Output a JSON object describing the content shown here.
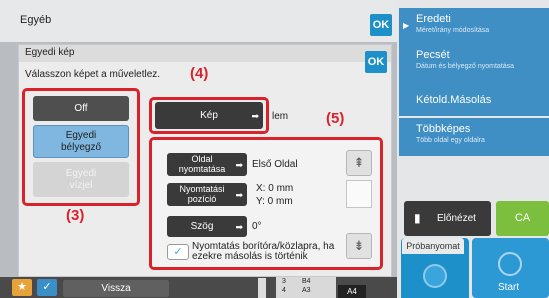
{
  "header": {
    "title": "Egyéb",
    "ok_label": "OK"
  },
  "dialog": {
    "title": "Egyedi kép",
    "ok_label": "OK",
    "instruction": "Válasszon képet a műveletlez.",
    "stamp_options": [
      {
        "label": "Off",
        "state": "normal"
      },
      {
        "label": "Egyedi bélyegző",
        "state": "selected"
      },
      {
        "label": "Egyedi vízjel",
        "state": "disabled"
      }
    ],
    "image_button_label": "Kép",
    "image_suffix": "lem",
    "settings": {
      "page_label": "Oldal nyomtatása",
      "page_value": "Első Oldal",
      "position_label": "Nyomtatási pozíció",
      "position_x": "X: 0 mm",
      "position_y": "Y: 0 mm",
      "angle_label": "Szög",
      "angle_value": "0°",
      "cover_text": "Nyomtatás borítóra/közlapra, ha ezekre másolás is történik"
    }
  },
  "callouts": {
    "c3": "(3)",
    "c4": "(4)",
    "c5": "(5)"
  },
  "right_panel": {
    "items": [
      {
        "main": "Eredeti",
        "sub": "Méret/irány módosítása"
      },
      {
        "main": "Pecsét",
        "sub": "Dátum és bélyegző nyomtatása"
      },
      {
        "main": "Kétold.Másolás",
        "sub": ""
      },
      {
        "main": "Többképes",
        "sub": "Több oldal egy oldalra"
      }
    ],
    "preview_label": "Előnézet",
    "ca_label": "CA",
    "trial_label": "Próbanyomat",
    "start_label": "Start"
  },
  "bottom": {
    "back_label": "Vissza",
    "tray_rows": [
      {
        "num": "3",
        "size": "B4"
      },
      {
        "num": "4",
        "size": "A3"
      }
    ],
    "paper_size": "A4"
  },
  "colors": {
    "accent": "#1d8fc9",
    "callout": "#d8232a",
    "ca_green": "#7cbf3e",
    "panel_blue": "#3f8fc4"
  }
}
